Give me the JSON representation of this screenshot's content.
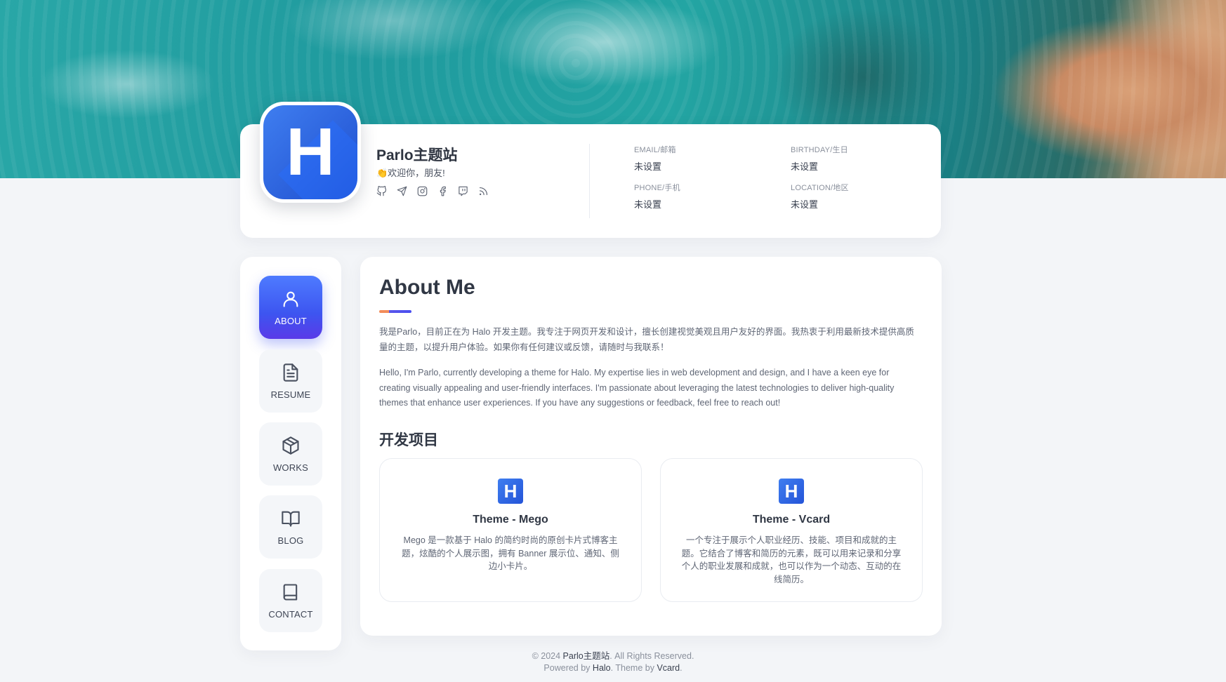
{
  "profile": {
    "avatar_letter": "H",
    "title": "Parlo主题站",
    "greeting": "👏欢迎你，朋友!",
    "social_icons": [
      "github-icon",
      "telegram-icon",
      "instagram-icon",
      "facebook-icon",
      "twitch-icon",
      "rss-icon"
    ],
    "info": {
      "email_label": "EMAIL/邮箱",
      "email_value": "未设置",
      "birthday_label": "BIRTHDAY/生日",
      "birthday_value": "未设置",
      "phone_label": "PHONE/手机",
      "phone_value": "未设置",
      "location_label": "LOCATION/地区",
      "location_value": "未设置"
    }
  },
  "nav": {
    "items": [
      {
        "label": "ABOUT",
        "icon": "user-icon",
        "active": true
      },
      {
        "label": "RESUME",
        "icon": "document-icon",
        "active": false
      },
      {
        "label": "WORKS",
        "icon": "cube-icon",
        "active": false
      },
      {
        "label": "BLOG",
        "icon": "open-book-icon",
        "active": false
      },
      {
        "label": "CONTACT",
        "icon": "book-icon",
        "active": false
      }
    ]
  },
  "about": {
    "title": "About Me",
    "para_cn": "我是Parlo，目前正在为 Halo 开发主题。我专注于网页开发和设计，擅长创建视觉美观且用户友好的界面。我热衷于利用最新技术提供高质量的主题，以提升用户体验。如果你有任何建议或反馈，请随时与我联系！",
    "para_en": "Hello, I'm Parlo, currently developing a theme for Halo. My expertise lies in web development and design, and I have a keen eye for creating visually appealing and user-friendly interfaces. I'm passionate about leveraging the latest technologies to deliver high-quality themes that enhance user experiences. If you have any suggestions or feedback, feel free to reach out!",
    "projects_title": "开发项目",
    "projects": [
      {
        "logo_letter": "H",
        "name": "Theme - Mego",
        "desc": "Mego 是一款基于 Halo 的简约时尚的原创卡片式博客主题，炫酷的个人展示图，拥有 Banner 展示位、通知、侧边小卡片。"
      },
      {
        "logo_letter": "H",
        "name": "Theme - Vcard",
        "desc": "一个专注于展示个人职业经历、技能、项目和成就的主题。它结合了博客和简历的元素，既可以用来记录和分享个人的职业发展和成就，也可以作为一个动态、互动的在线简历。"
      }
    ]
  },
  "footer": {
    "copyright_prefix": "© 2024",
    "site_name": "Parlo主题站",
    "rights": ". All Rights Reserved.",
    "powered_prefix": "Powered by",
    "halo": "Halo",
    "theme_by": ". Theme by",
    "vcard": "Vcard",
    "end": "."
  }
}
